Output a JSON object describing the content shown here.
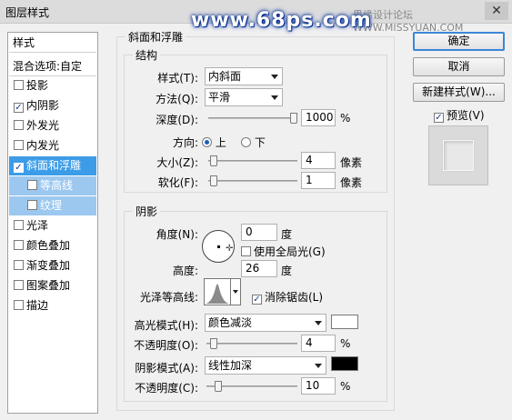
{
  "window": {
    "title": "图层样式",
    "close": "✕"
  },
  "watermark": {
    "site": "www.68ps.com",
    "forum": "思缘设计论坛 WWW.MISSYUAN.COM"
  },
  "style_list": {
    "header": "样式",
    "blend": "混合选项:自定",
    "items": [
      {
        "label": "投影",
        "checked": ""
      },
      {
        "label": "内阴影",
        "checked": "✓"
      },
      {
        "label": "外发光",
        "checked": ""
      },
      {
        "label": "内发光",
        "checked": ""
      },
      {
        "label": "斜面和浮雕",
        "checked": "✓"
      },
      {
        "label": "等高线",
        "checked": ""
      },
      {
        "label": "纹理",
        "checked": ""
      },
      {
        "label": "光泽",
        "checked": ""
      },
      {
        "label": "颜色叠加",
        "checked": ""
      },
      {
        "label": "渐变叠加",
        "checked": ""
      },
      {
        "label": "图案叠加",
        "checked": ""
      },
      {
        "label": "描边",
        "checked": ""
      }
    ]
  },
  "bevel": {
    "section_title": "斜面和浮雕",
    "structure": {
      "title": "结构",
      "style_label": "样式(T):",
      "style_value": "内斜面",
      "technique_label": "方法(Q):",
      "technique_value": "平滑",
      "depth_label": "深度(D):",
      "depth_value": "1000",
      "depth_unit": "%",
      "depth_level": 1.0,
      "direction_label": "方向:",
      "dir_up": "上",
      "dir_down": "下",
      "size_label": "大小(Z):",
      "size_value": "4",
      "size_unit": "像素",
      "size_level": 0.02,
      "soften_label": "软化(F):",
      "soften_value": "1",
      "soften_unit": "像素",
      "soften_level": 0.02
    },
    "shading": {
      "title": "阴影",
      "angle_label": "角度(N):",
      "angle_value": "0",
      "angle_unit": "度",
      "global_light": "使用全局光(G)",
      "altitude_label": "高度:",
      "altitude_value": "26",
      "altitude_unit": "度",
      "gloss_label": "光泽等高线:",
      "antialias": "消除锯齿(L)",
      "highlight_label": "高光模式(H):",
      "highlight_mode": "颜色减淡",
      "highlight_color": "#ffffff",
      "hl_opacity_label": "不透明度(O):",
      "hl_opacity_value": "4",
      "hl_opacity_unit": "%",
      "hl_opacity_level": 0.04,
      "shadow_label": "阴影模式(A):",
      "shadow_mode": "线性加深",
      "shadow_color": "#000000",
      "sh_opacity_label": "不透明度(C):",
      "sh_opacity_value": "10",
      "sh_opacity_unit": "%",
      "sh_opacity_level": 0.1
    }
  },
  "buttons": {
    "ok": "确定",
    "cancel": "取消",
    "new_style": "新建样式(W)...",
    "preview": "预览(V)",
    "preview_checked": "✓"
  }
}
